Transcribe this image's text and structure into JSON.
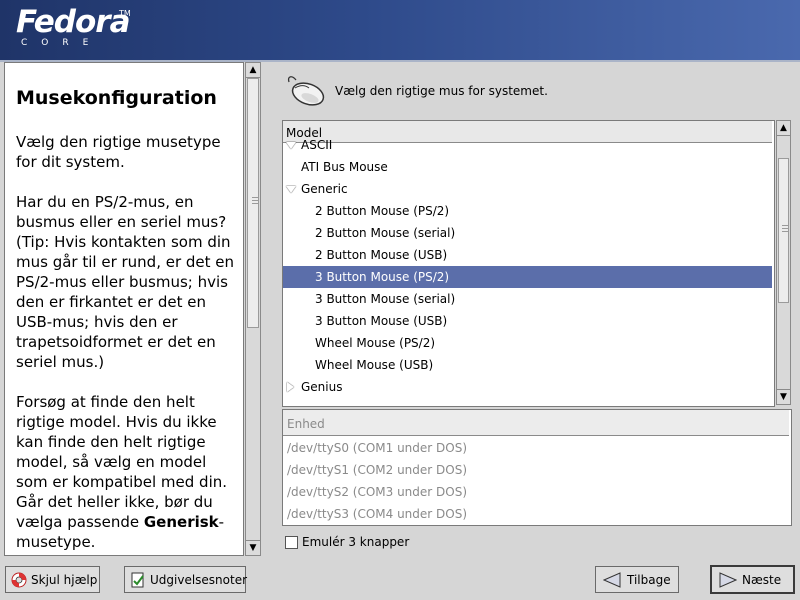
{
  "header": {
    "logo_main": "Fedora",
    "logo_tm": "TM",
    "logo_sub": "CORE"
  },
  "help": {
    "title": "Musekonfiguration",
    "p1": "Vælg den rigtige musetype for dit system.",
    "p2": "Har du en PS/2-mus, en busmus eller en seriel mus? (Tip: Hvis kontakten som din mus går til er rund, er det en PS/2-mus eller busmus; hvis den er firkantet er det en USB-mus; hvis den er trapetsoidformet er det en seriel mus.)",
    "p3_before": "Forsøg at finde den helt rigtige model. Hvis du ikke kan finde den helt rigtige model, så vælg en model som er kompatibel med din. Går det heller ikke, bør du vælga passende ",
    "p3_bold": "Generisk",
    "p3_after": "-musetype."
  },
  "mouse": {
    "icon": "mouse-icon",
    "prompt": "Vælg den rigtige mus for systemet."
  },
  "model_list": {
    "header": "Model",
    "rows": [
      {
        "label": "ASCII",
        "level": 0,
        "expander": "expanded",
        "selected": false
      },
      {
        "label": "ATI Bus Mouse",
        "level": 0,
        "expander": "none",
        "selected": false
      },
      {
        "label": "Generic",
        "level": 0,
        "expander": "expanded",
        "selected": false
      },
      {
        "label": "2 Button Mouse (PS/2)",
        "level": 1,
        "expander": "none",
        "selected": false
      },
      {
        "label": "2 Button Mouse (serial)",
        "level": 1,
        "expander": "none",
        "selected": false
      },
      {
        "label": "2 Button Mouse (USB)",
        "level": 1,
        "expander": "none",
        "selected": false
      },
      {
        "label": "3 Button Mouse (PS/2)",
        "level": 1,
        "expander": "none",
        "selected": true
      },
      {
        "label": "3 Button Mouse (serial)",
        "level": 1,
        "expander": "none",
        "selected": false
      },
      {
        "label": "3 Button Mouse (USB)",
        "level": 1,
        "expander": "none",
        "selected": false
      },
      {
        "label": "Wheel Mouse (PS/2)",
        "level": 1,
        "expander": "none",
        "selected": false
      },
      {
        "label": "Wheel Mouse (USB)",
        "level": 1,
        "expander": "none",
        "selected": false
      },
      {
        "label": "Genius",
        "level": 0,
        "expander": "collapsed",
        "selected": false
      }
    ],
    "selection_color": "#5b6eaa"
  },
  "device_list": {
    "header": "Enhed",
    "rows": [
      "/dev/ttyS0 (COM1 under DOS)",
      "/dev/ttyS1 (COM2 under DOS)",
      "/dev/ttyS2 (COM3 under DOS)",
      "/dev/ttyS3 (COM4 under DOS)"
    ]
  },
  "emulate": {
    "label": "Emulér 3 knapper",
    "checked": false
  },
  "buttons": {
    "hide_help": "Skjul hjælp",
    "release_notes": "Udgivelsesnoter",
    "back": "Tilbage",
    "next": "Næste"
  },
  "colors": {
    "header_dark": "#1f3468",
    "header_light": "#4a69ae",
    "background": "#d6d6d6"
  }
}
